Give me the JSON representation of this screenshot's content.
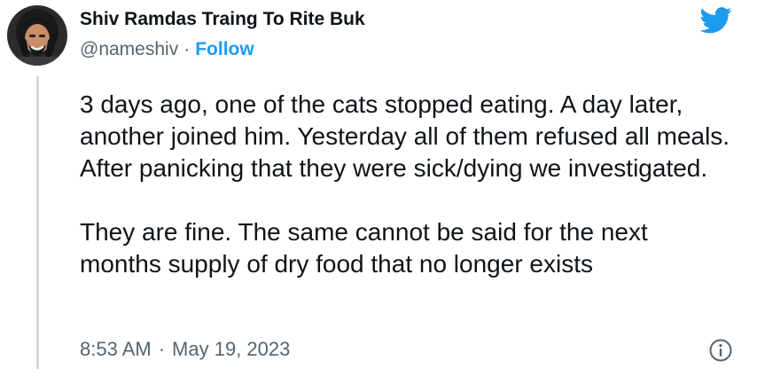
{
  "author": {
    "name": "Shiv Ramdas Traing To Rite Buk",
    "handle": "@nameshiv",
    "separator": "·",
    "follow_label": "Follow"
  },
  "tweet": {
    "paragraph_1": "3 days ago, one of the cats stopped eating. A day later, another joined him. Yesterday all of them refused all meals. After panicking that they were sick/dying we investigated.",
    "paragraph_2": "They are fine. The same cannot be said for the next months supply of dry food that no longer exists"
  },
  "footer": {
    "time": "8:53 AM",
    "separator": "·",
    "date": "May 19, 2023"
  },
  "icons": {
    "brand": "twitter-bird-icon",
    "info": "info-icon"
  },
  "colors": {
    "accent": "#1d9bf0",
    "text": "#0f1419",
    "secondary": "#536471",
    "thread_line": "#cfd9de"
  }
}
